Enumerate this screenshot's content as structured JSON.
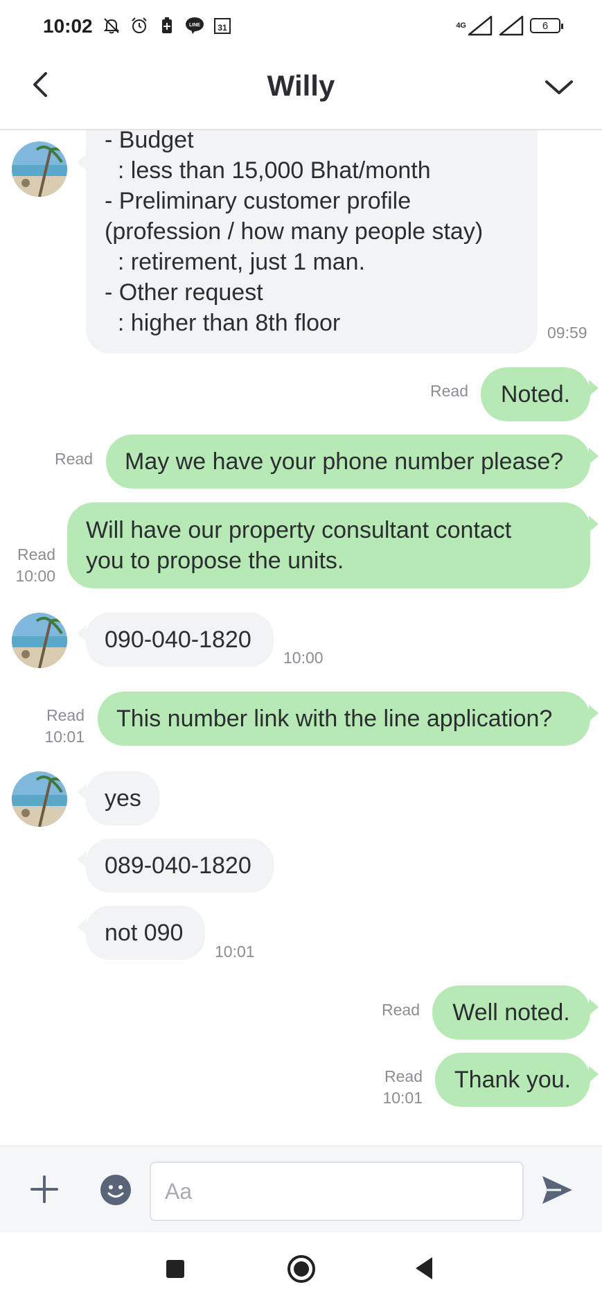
{
  "status_bar": {
    "time": "10:02",
    "calendar_day": "31",
    "network": "4G",
    "battery": "6",
    "line_badge": "LINE"
  },
  "header": {
    "title": "Willy"
  },
  "messages": [
    {
      "dir": "in",
      "lines": [
        "- Budget",
        "  : less than 15,000 Bhat/month",
        "- Preliminary customer profile",
        "(profession / how many people stay)",
        "  : retirement, just 1 man.",
        "- Other request",
        "  : higher than 8th floor"
      ],
      "time": "09:59"
    },
    {
      "dir": "out",
      "text": "Noted.",
      "read": "Read"
    },
    {
      "dir": "out",
      "text": "May we have your phone number please?",
      "read": "Read"
    },
    {
      "dir": "out",
      "lines": [
        "Will have our property consultant contact",
        "you to propose the units."
      ],
      "read": "Read",
      "time": "10:00"
    },
    {
      "dir": "in",
      "text": "090-040-1820",
      "time": "10:00"
    },
    {
      "dir": "out",
      "text": "This number link with the line application?",
      "read": "Read",
      "time": "10:01"
    },
    {
      "dir": "in",
      "text": "yes"
    },
    {
      "dir": "in",
      "text": "089-040-1820"
    },
    {
      "dir": "in",
      "text": "not 090",
      "time": "10:01"
    },
    {
      "dir": "out",
      "text": "Well noted.",
      "read": "Read"
    },
    {
      "dir": "out",
      "text": "Thank you.",
      "read": "Read",
      "time": "10:01"
    }
  ],
  "input": {
    "placeholder": "Aa"
  },
  "icons": {
    "back": "chevron-left-icon",
    "expand": "chevron-down-icon",
    "add": "plus-icon",
    "emoji": "emoji-icon",
    "send": "send-icon"
  },
  "colors": {
    "outgoing_bubble": "#b7e9b4",
    "incoming_bubble": "#f2f3f5",
    "meta_text": "#8a8d93",
    "icon_slate": "#5a6478"
  }
}
